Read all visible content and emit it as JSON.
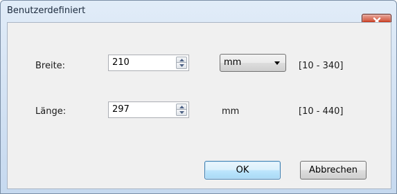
{
  "window": {
    "title": "Benutzerdefiniert"
  },
  "width": {
    "label": "Breite:",
    "value": "210",
    "unit_selected": "mm",
    "range": "[10 - 340]"
  },
  "length": {
    "label": "Länge:",
    "value": "297",
    "unit": "mm",
    "range": "[10 - 440]"
  },
  "buttons": {
    "ok": "OK",
    "cancel": "Abbrechen"
  },
  "icons": {
    "close": "close-icon",
    "up": "chevron-up-icon",
    "down": "chevron-down-icon"
  }
}
